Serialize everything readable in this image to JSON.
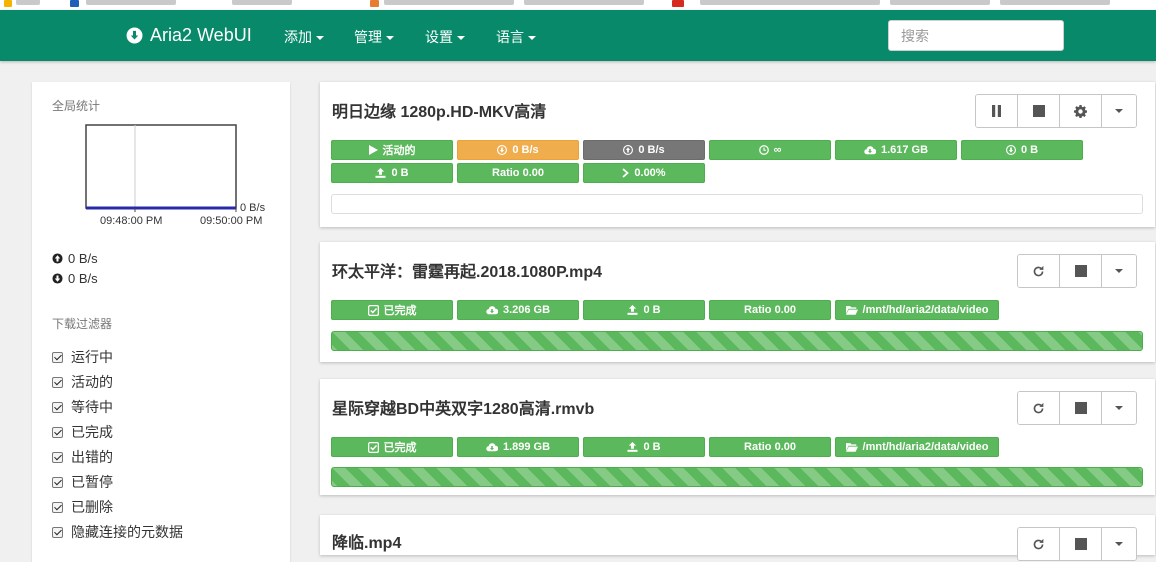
{
  "app": {
    "brand": "Aria2 WebUI"
  },
  "nav": [
    {
      "label": "添加"
    },
    {
      "label": "管理"
    },
    {
      "label": "设置"
    },
    {
      "label": "语言"
    }
  ],
  "search": {
    "placeholder": "搜索",
    "value": ""
  },
  "sidebar": {
    "stats_title": "全局统计",
    "chart_ylabel": "0 B/s",
    "chart_times": [
      "09:48:00 PM",
      "09:50:00 PM"
    ],
    "upload_speed": "0 B/s",
    "download_speed": "0 B/s",
    "filter_title": "下载过滤器",
    "filters": [
      "运行中",
      "活动的",
      "等待中",
      "已完成",
      "出错的",
      "已暂停",
      "已删除",
      "隐藏连接的元数据"
    ]
  },
  "downloads": [
    {
      "name": "明日边缘 1280p.HD-MKV高清",
      "status": "活动的",
      "download_speed": "0 B/s",
      "upload_speed": "0 B/s",
      "eta": "∞",
      "size": "1.617 GB",
      "downloaded": "0 B",
      "uploaded": "0 B",
      "ratio": "Ratio 0.00",
      "progress": "0.00%",
      "progress_fraction": 0.0
    },
    {
      "name": "环太平洋：雷霆再起.2018.1080P.mp4",
      "status": "已完成",
      "size": "3.206 GB",
      "uploaded": "0 B",
      "ratio": "Ratio 0.00",
      "path": "/mnt/hd/aria2/data/video",
      "progress_fraction": 1.0
    },
    {
      "name": "星际穿越BD中英双字1280高清.rmvb",
      "status": "已完成",
      "size": "1.899 GB",
      "uploaded": "0 B",
      "ratio": "Ratio 0.00",
      "path": "/mnt/hd/aria2/data/video",
      "progress_fraction": 1.0
    },
    {
      "name": "降临.mp4"
    }
  ],
  "colors": {
    "navbar": "#088a6a",
    "success": "#5cb85c",
    "warning": "#f0ad4e",
    "default": "#777777"
  }
}
